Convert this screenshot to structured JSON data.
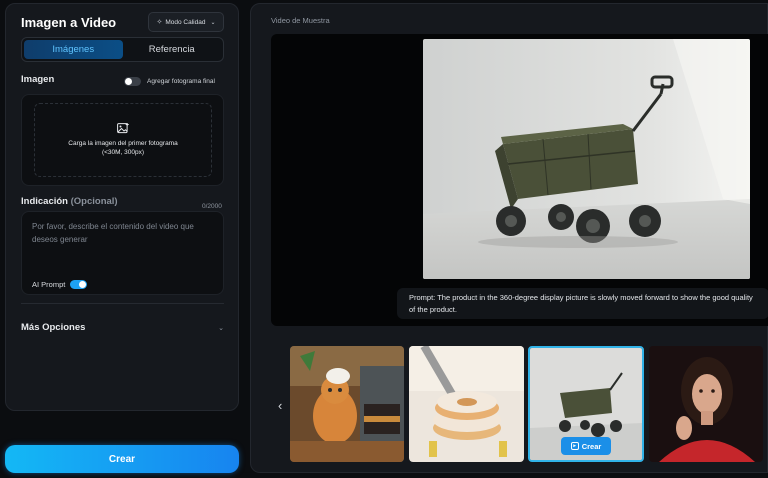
{
  "left_panel": {
    "title": "Imagen a Video",
    "mode_button": "Modo Calidad",
    "tabs": [
      {
        "label": "Imágenes",
        "active": true
      },
      {
        "label": "Referencia",
        "active": false
      }
    ],
    "image_section_label": "Imagen",
    "last_frame_toggle_label": "Agregar fotograma final",
    "upload": {
      "line1": "Carga la imagen del primer fotograma",
      "line2": "(<30M, 300px)"
    },
    "prompt_section_label": "Indicación",
    "prompt_optional": "(Opcional)",
    "prompt_counter": "0/2000",
    "prompt_placeholder": "Por favor, describe el contenido del video que deseos generar",
    "ai_prompt_label": "AI Prompt",
    "more_options_label": "Más Opciones"
  },
  "create_button": "Crear",
  "right_panel": {
    "title": "Video de Muestra",
    "caption": "Prompt:   The product in the 360-degree display picture is slowly moved forward to show the good quality of the product.",
    "thumbnail_button": "Crear"
  },
  "colors": {
    "accent": "#1da1f2",
    "panel_bg": "#15181d",
    "page_bg": "#0b0d10"
  }
}
